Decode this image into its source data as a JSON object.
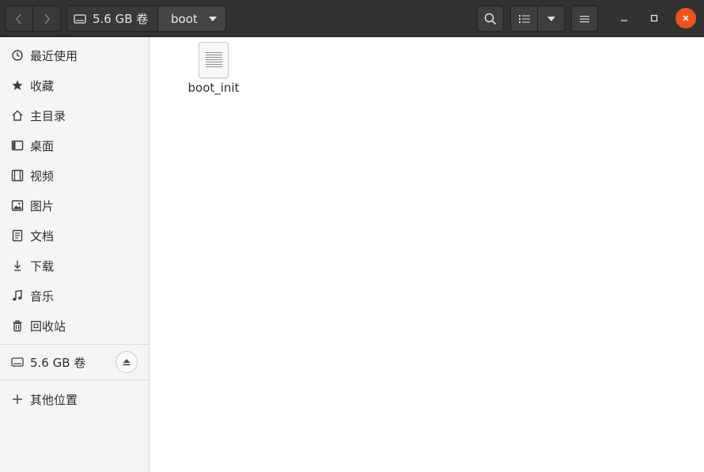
{
  "header": {
    "volume_label": "5.6 GB 卷",
    "current_folder": "boot"
  },
  "sidebar": {
    "items": [
      {
        "label": "最近使用",
        "icon": "recent-icon"
      },
      {
        "label": "收藏",
        "icon": "star-icon"
      },
      {
        "label": "主目录",
        "icon": "home-icon"
      },
      {
        "label": "桌面",
        "icon": "desktop-icon"
      },
      {
        "label": "视频",
        "icon": "video-icon"
      },
      {
        "label": "图片",
        "icon": "picture-icon"
      },
      {
        "label": "文档",
        "icon": "document-icon"
      },
      {
        "label": "下载",
        "icon": "download-icon"
      },
      {
        "label": "音乐",
        "icon": "music-icon"
      },
      {
        "label": "回收站",
        "icon": "trash-icon"
      }
    ],
    "volume": {
      "label": "5.6 GB 卷",
      "icon": "drive-icon"
    },
    "other_locations": {
      "label": "其他位置",
      "icon": "plus-icon"
    }
  },
  "content": {
    "files": [
      {
        "name": "boot_init",
        "icon": "text-file-icon"
      }
    ]
  },
  "colors": {
    "headerbar": "#333231",
    "close_button": "#e95420",
    "sidebar_bg": "#f5f5f5"
  }
}
